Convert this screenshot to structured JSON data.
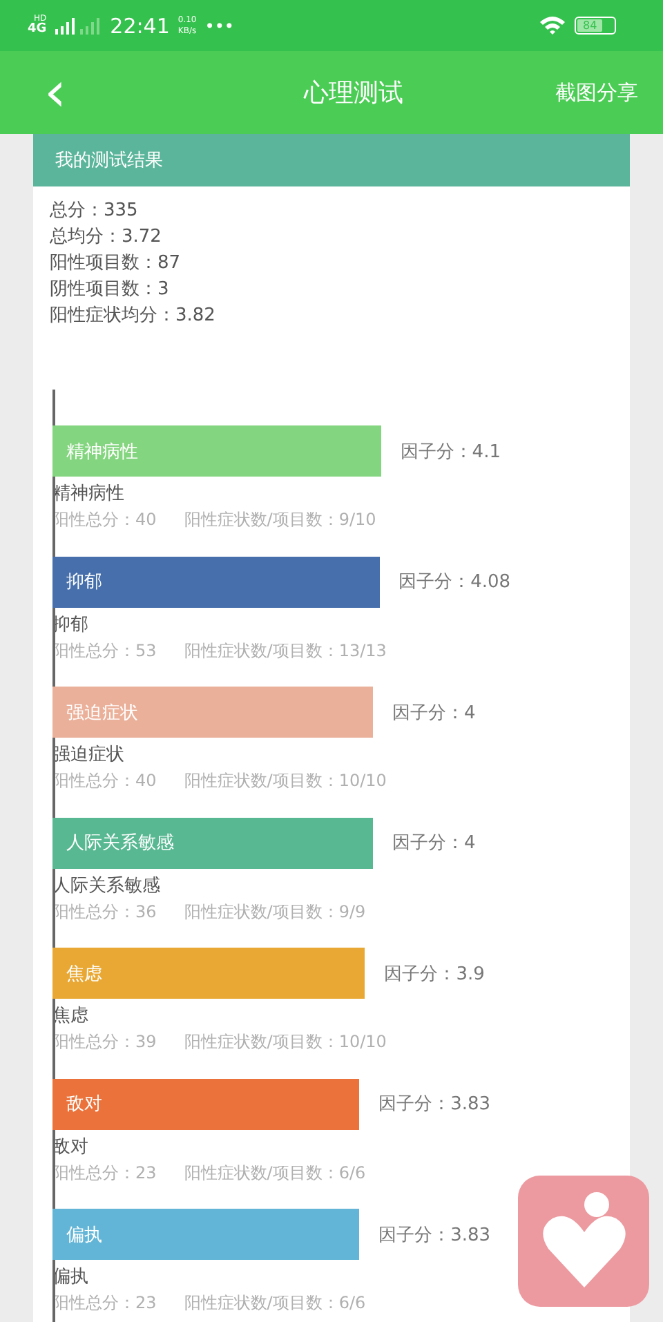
{
  "status_bar": {
    "network": "4G",
    "network_badge": "HD",
    "time": "22:41",
    "speed_value": "0.10",
    "speed_unit": "KB/s",
    "more": "•••",
    "battery": "84"
  },
  "header": {
    "back": "‹",
    "title": "心理测试",
    "action": "截图分享"
  },
  "result": {
    "title": "我的测试结果",
    "summary": [
      "总分：335",
      "总均分：3.72",
      "阳性项目数：87",
      "阴性项目数：3",
      "阳性症状均分：3.82"
    ],
    "factors": [
      {
        "name": "精神病性",
        "score": "因子分：4.1",
        "color": "#84d57f",
        "label": "精神病性",
        "total": "阳性总分：40",
        "ratio": "阳性症状数/项目数：9/10"
      },
      {
        "name": "抑郁",
        "score": "因子分：4.08",
        "color": "#466fab",
        "label": "抑郁",
        "total": "阳性总分：53",
        "ratio": "阳性症状数/项目数：13/13"
      },
      {
        "name": "强迫症状",
        "score": "因子分：4",
        "color": "#ebb09a",
        "label": "强迫症状",
        "total": "阳性总分：40",
        "ratio": "阳性症状数/项目数：10/10"
      },
      {
        "name": "人际关系敏感",
        "score": "因子分：4",
        "color": "#58b892",
        "label": "人际关系敏感",
        "total": "阳性总分：36",
        "ratio": "阳性症状数/项目数：9/9"
      },
      {
        "name": "焦虑",
        "score": "因子分：3.9",
        "color": "#e9a834",
        "label": "焦虑",
        "total": "阳性总分：39",
        "ratio": "阳性症状数/项目数：10/10"
      },
      {
        "name": "敌对",
        "score": "因子分：3.83",
        "color": "#eb733b",
        "label": "敌对",
        "total": "阳性总分：23",
        "ratio": "阳性症状数/项目数：6/6"
      },
      {
        "name": "偏执",
        "score": "因子分：3.83",
        "color": "#62b5d6",
        "label": "偏执",
        "total": "阳性总分：23",
        "ratio": "阳性症状数/项目数：6/6"
      }
    ]
  }
}
